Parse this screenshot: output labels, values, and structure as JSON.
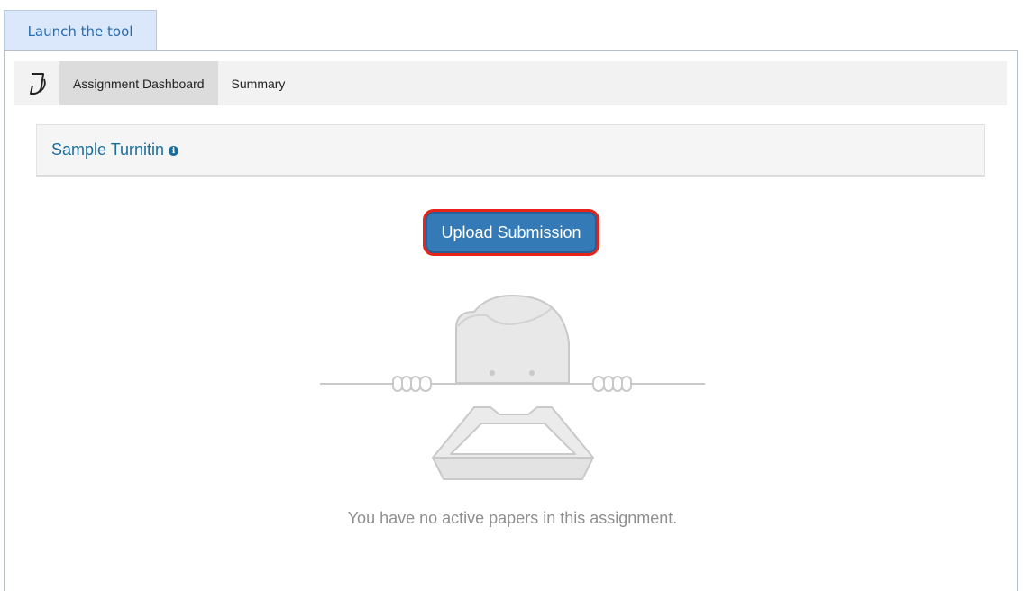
{
  "launch_tab": {
    "label": "Launch the tool"
  },
  "navbar": {
    "logo_icon": "turnitin-logo-icon",
    "tabs": [
      {
        "label": "Assignment Dashboard",
        "active": true
      },
      {
        "label": "Summary",
        "active": false
      }
    ]
  },
  "assignment": {
    "title": "Sample Turnitin",
    "info_icon": "info-circle-icon"
  },
  "upload_button": {
    "label": "Upload Submission"
  },
  "empty_state": {
    "illustration": "person-peeking-over-tray-illustration",
    "message": "You have no active papers in this assignment."
  },
  "colors": {
    "accent": "#337ab7",
    "link": "#1a6e9a",
    "highlight": "#e8241a"
  }
}
